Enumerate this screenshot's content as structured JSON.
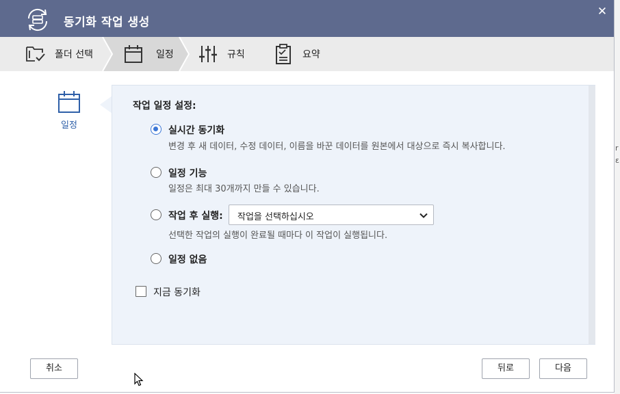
{
  "dialog": {
    "title": "동기화 작업 생성",
    "close_glyph": "✕"
  },
  "steps": [
    {
      "label": "폴더 선택",
      "icon": "folder-check-icon",
      "active": false
    },
    {
      "label": "일정",
      "icon": "calendar-icon",
      "active": true
    },
    {
      "label": "규칙",
      "icon": "sliders-icon",
      "active": false
    },
    {
      "label": "요약",
      "icon": "clipboard-check-icon",
      "active": false
    }
  ],
  "side": {
    "label": "일정",
    "icon": "calendar-icon"
  },
  "schedule": {
    "section_title": "작업 일정 설정:",
    "options": [
      {
        "label": "실시간 동기화",
        "desc": "변경 후 새 데이터, 수정 데이터, 이름을 바꾼 데이터를 원본에서 대상으로 즉시 복사합니다.",
        "checked": true
      },
      {
        "label": "일정 기능",
        "desc": "일정은 최대 30개까지 만들 수 있습니다.",
        "checked": false
      },
      {
        "label": "작업 후 실행:",
        "desc": "선택한 작업의 실행이 완료될 때마다 이 작업이 실행됩니다.",
        "checked": false
      },
      {
        "label": "일정 없음",
        "desc": "",
        "checked": false
      }
    ],
    "task_select": {
      "value": "작업을 선택하십시오"
    },
    "sync_now": {
      "label": "지금 동기화",
      "checked": false
    }
  },
  "footer": {
    "cancel": "취소",
    "back": "뒤로",
    "next": "다음"
  },
  "colors": {
    "titlebar": "#5e6a8e",
    "accent": "#3c77d6",
    "panel": "#eef3fa",
    "steps_bar": "#ebebeb",
    "active_step": "#d8d8d8"
  }
}
